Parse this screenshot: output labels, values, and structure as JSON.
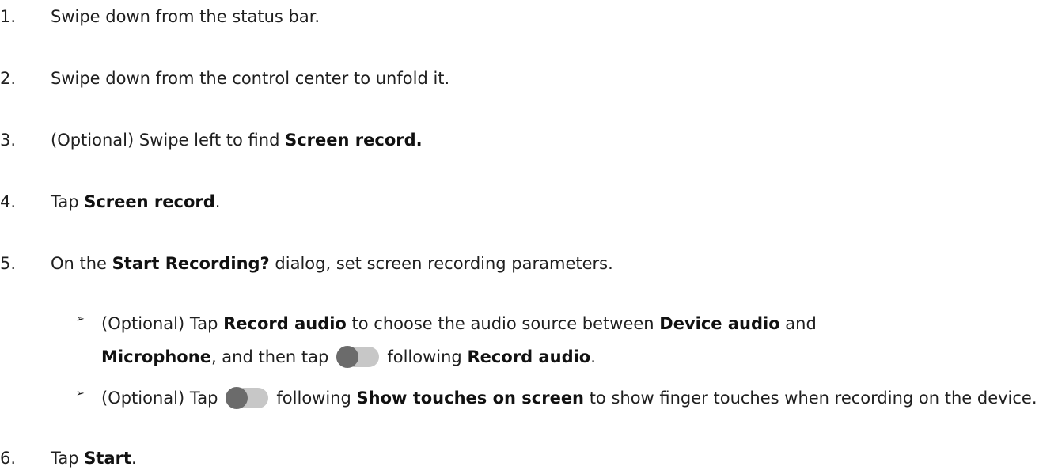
{
  "steps": [
    {
      "num": "1.",
      "parts": [
        "Swipe down from the status bar."
      ]
    },
    {
      "num": "2.",
      "parts": [
        "Swipe down from the control center to unfold it."
      ]
    },
    {
      "num": "3.",
      "pre": "(Optional) Swipe left to find ",
      "bold": "Screen record."
    },
    {
      "num": "4.",
      "pre": "Tap ",
      "bold": "Screen record",
      "post": "."
    },
    {
      "num": "5.",
      "pre": "On the ",
      "bold": "Start Recording?",
      "post": " dialog, set screen recording parameters."
    },
    {
      "num": "6.",
      "pre": "Tap ",
      "bold": "Start",
      "post": "."
    }
  ],
  "substeps": [
    {
      "bullet": "➢",
      "a": "(Optional) Tap ",
      "b": "Record audio",
      "c": " to choose the audio source between ",
      "d": "Device audio",
      "e": " and ",
      "f": "Microphone",
      "g": ", and then tap",
      "h": "following ",
      "i": "Record audio",
      "j": "."
    },
    {
      "bullet": "➢",
      "a": "(Optional) Tap",
      "b": "following ",
      "c": "Show touches on screen",
      "d": " to show finger touches when recording on the device."
    }
  ]
}
